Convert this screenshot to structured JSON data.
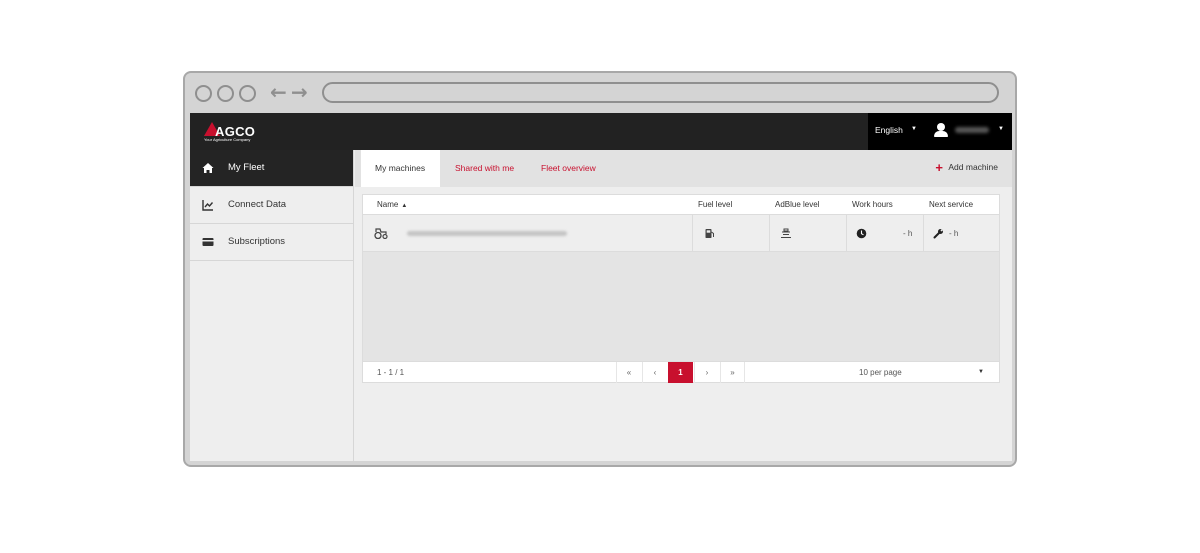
{
  "app": {
    "logo": {
      "name": "AGCO",
      "tagline": "Your Agriculture Company"
    },
    "brand_color": "#c8102e"
  },
  "topbar": {
    "language": "English",
    "user_icon": "user-icon"
  },
  "sidebar": {
    "items": [
      {
        "label": "My Fleet",
        "icon": "home-icon",
        "active": true
      },
      {
        "label": "Connect Data",
        "icon": "chart-icon",
        "active": false
      },
      {
        "label": "Subscriptions",
        "icon": "credit-card-icon",
        "active": false
      }
    ]
  },
  "tabs": [
    {
      "label": "My machines",
      "active": true
    },
    {
      "label": "Shared with me",
      "active": false
    },
    {
      "label": "Fleet overview",
      "active": false
    }
  ],
  "add_machine_label": "Add machine",
  "table": {
    "columns": [
      "Name",
      "Fuel level",
      "AdBlue level",
      "Work hours",
      "Next service"
    ],
    "rows": [
      {
        "icon": "tractor-icon",
        "work_hours": "- h",
        "next_service": "- h"
      }
    ]
  },
  "pagination": {
    "range": "1 - 1 / 1",
    "first": "«",
    "prev": "‹",
    "current": "1",
    "next": "›",
    "last": "»",
    "per_page": "10 per page"
  }
}
